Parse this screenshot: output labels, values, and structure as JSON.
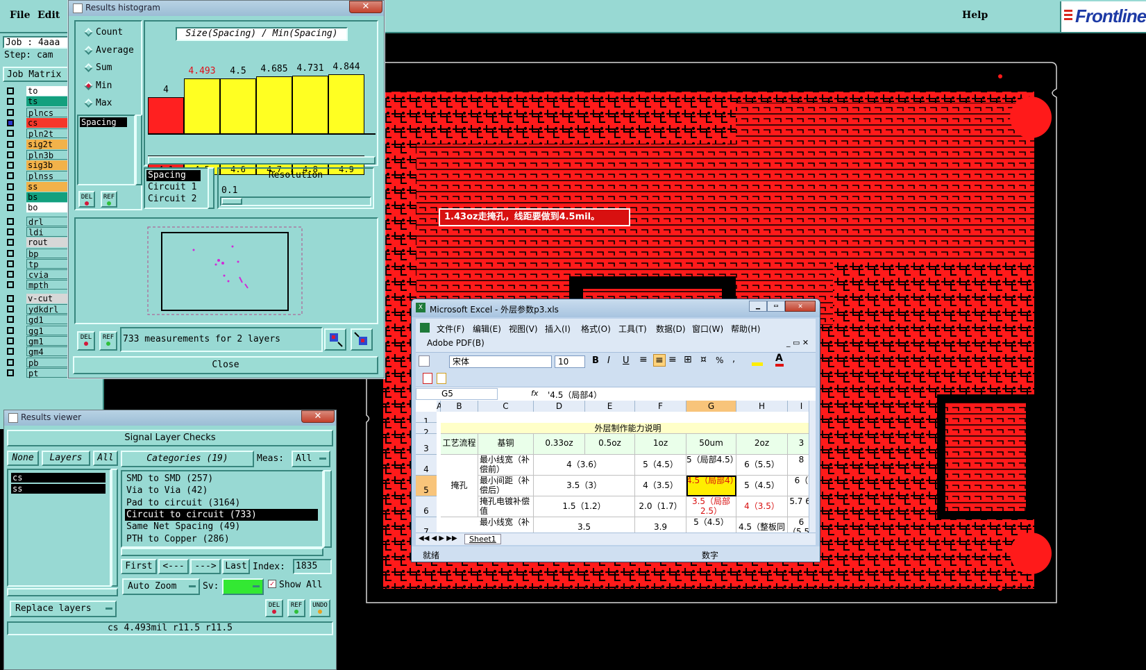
{
  "main_menu": {
    "file": "File",
    "edit": "Edit",
    "help": "Help",
    "logo": "Frontline"
  },
  "job": {
    "job_label": "Job : 4aaa",
    "step_label": "Step: cam",
    "matrix_button": "Job Matrix"
  },
  "layers": [
    {
      "name": "to",
      "color": "#ffffff"
    },
    {
      "name": "ts",
      "color": "#13a07e"
    },
    {
      "name": "plncs",
      "color": "#98d9d3"
    },
    {
      "name": "cs",
      "color": "#f5372a",
      "active": true
    },
    {
      "name": "pln2t",
      "color": "#98d9d3"
    },
    {
      "name": "sig2t",
      "color": "#f2b24a"
    },
    {
      "name": "pln3b",
      "color": "#98d9d3"
    },
    {
      "name": "sig3b",
      "color": "#f2b24a"
    },
    {
      "name": "plnss",
      "color": "#98d9d3"
    },
    {
      "name": "ss",
      "color": "#f2b24a"
    },
    {
      "name": "bs",
      "color": "#13a07e"
    },
    {
      "name": "bo",
      "color": "#ffffff"
    },
    {
      "name": "drl",
      "color": "#98d9d3"
    },
    {
      "name": "ldi",
      "color": "#98d9d3"
    },
    {
      "name": "rout",
      "color": "#d7d7d7"
    },
    {
      "name": "bp",
      "color": "#98d9d3"
    },
    {
      "name": "tp",
      "color": "#98d9d3"
    },
    {
      "name": "cvia",
      "color": "#98d9d3"
    },
    {
      "name": "mpth",
      "color": "#98d9d3"
    },
    {
      "name": "v-cut",
      "color": "#d7d7d7"
    },
    {
      "name": "ydkdrl",
      "color": "#98d9d3"
    },
    {
      "name": "gd1",
      "color": "#98d9d3"
    },
    {
      "name": "gg1",
      "color": "#98d9d3"
    },
    {
      "name": "gm1",
      "color": "#98d9d3"
    },
    {
      "name": "gm4",
      "color": "#98d9d3"
    },
    {
      "name": "pb",
      "color": "#98d9d3"
    },
    {
      "name": "pt",
      "color": "#98d9d3"
    }
  ],
  "histogram": {
    "title": "Results histogram",
    "close_x": "✕",
    "chart_title": "Size(Spacing) / Min(Spacing)",
    "options": [
      "Count",
      "Average",
      "Sum",
      "Min",
      "Max"
    ],
    "selected_option": "Min",
    "attr_list": [
      "Spacing"
    ],
    "type_list": [
      "Spacing",
      "Circuit 1",
      "Circuit 2"
    ],
    "resolution_label": "Resolution",
    "resolution_value": "0.1",
    "summary": "733 measurements for 2 layers",
    "close_button": "Close",
    "del": "DEL",
    "ref": "REF"
  },
  "chart_data": {
    "type": "bar",
    "title": "Size(Spacing) / Min(Spacing)",
    "categories": [
      "4-4.1",
      "4.4-4.5",
      "4.5-4.6",
      "4.6-4.7",
      "4.7-4.8",
      "4.8-4.9"
    ],
    "category_lines": [
      [
        "4-",
        "4.1"
      ],
      [
        "4.4-",
        "4.5"
      ],
      [
        "4.5-",
        "4.6"
      ],
      [
        "4.6-",
        "4.7"
      ],
      [
        "4.7-",
        "4.8"
      ],
      [
        "4.8-",
        "4.9"
      ]
    ],
    "values": [
      4,
      4.493,
      4.5,
      4.685,
      4.731,
      4.844
    ],
    "labels": [
      "4",
      "4.493",
      "4.5",
      "4.685",
      "4.731",
      "4.844"
    ],
    "colors": [
      "#ff2020",
      "#ffff22",
      "#ffff22",
      "#ffff22",
      "#ffff22",
      "#ffff22"
    ],
    "label_colors": [
      "#000000",
      "#e0101a",
      "#000000",
      "#000000",
      "#000000",
      "#000000"
    ],
    "ylim": [
      0,
      4.844
    ]
  },
  "results_viewer": {
    "title": "Results viewer",
    "header": "Signal Layer Checks",
    "none": "None",
    "layers": "Layers",
    "all": "All",
    "layer_items": [
      "cs",
      "ss"
    ],
    "categories_label": "Categories (19)",
    "meas_label": "Meas:",
    "meas_value": "All",
    "categories": [
      "SMD to SMD (257)",
      "Via to Via (42)",
      "Pad to circuit (3164)",
      "Circuit to circuit (733)",
      "Same Net Spacing (49)",
      "PTH to Copper (286)"
    ],
    "selected_category": 3,
    "first": "First",
    "prev": "<---",
    "next": "--->",
    "last": "Last",
    "index_label": "Index:",
    "index_value": "1835",
    "auto_zoom": "Auto Zoom",
    "sv_label": "Sv:",
    "show_all": "Show All",
    "replace_layers": "Replace layers",
    "undo": "UNDO",
    "status": "cs 4.493mil  r11.5  r11.5"
  },
  "annotation": "1.43oz走掩孔，线距要做到4.5mil。",
  "excel": {
    "title": "Microsoft Excel - 外层参数p3.xls",
    "menus": [
      "文件(F)",
      "编辑(E)",
      "视图(V)",
      "插入(I)",
      "格式(O)",
      "工具(T)",
      "数据(D)",
      "窗口(W)",
      "帮助(H)"
    ],
    "adobe": "Adobe PDF(B)",
    "font_name": "宋体",
    "font_size": "10",
    "name_box": "G5",
    "fx": "fx",
    "formula": "'4.5（局部4）",
    "columns": [
      "A",
      "B",
      "C",
      "D",
      "E",
      "F",
      "G",
      "H",
      "I"
    ],
    "rows": [
      "1",
      "2",
      "3",
      "4",
      "5",
      "6",
      "7"
    ],
    "table_title": "外层制作能力说明",
    "hdr": [
      "工艺流程",
      "基铜",
      "0.33oz",
      "0.5oz",
      "1oz",
      "50um",
      "2oz",
      "3"
    ],
    "process": "掩孔",
    "r4": [
      "最小线宽（补偿前）",
      "4（3.6）",
      "5（4.5）",
      "5（局部4.5）",
      "6（5.5）",
      "8"
    ],
    "r5": [
      "最小间距（补偿后）",
      "3.5（3）",
      "4（3.5）",
      "4.5（局部4）",
      "5（4.5）",
      "6（"
    ],
    "r6": [
      "掩孔电镀补偿值",
      "1.5（1.2）",
      "2.0（1.7）",
      "3.5（局部2.5）",
      "4（3.5）",
      "5.7 6."
    ],
    "r7": [
      "最小线宽（补",
      "3.5",
      "3.9",
      "5（4.5）",
      "4.5（整板同形直线",
      "6（5.5）"
    ],
    "sheet_tab": "Sheet1",
    "status_ready": "就绪",
    "status_num": "数字",
    "bold": "B",
    "italic": "I",
    "underline": "U",
    "percent": "%",
    "comma": ","
  }
}
